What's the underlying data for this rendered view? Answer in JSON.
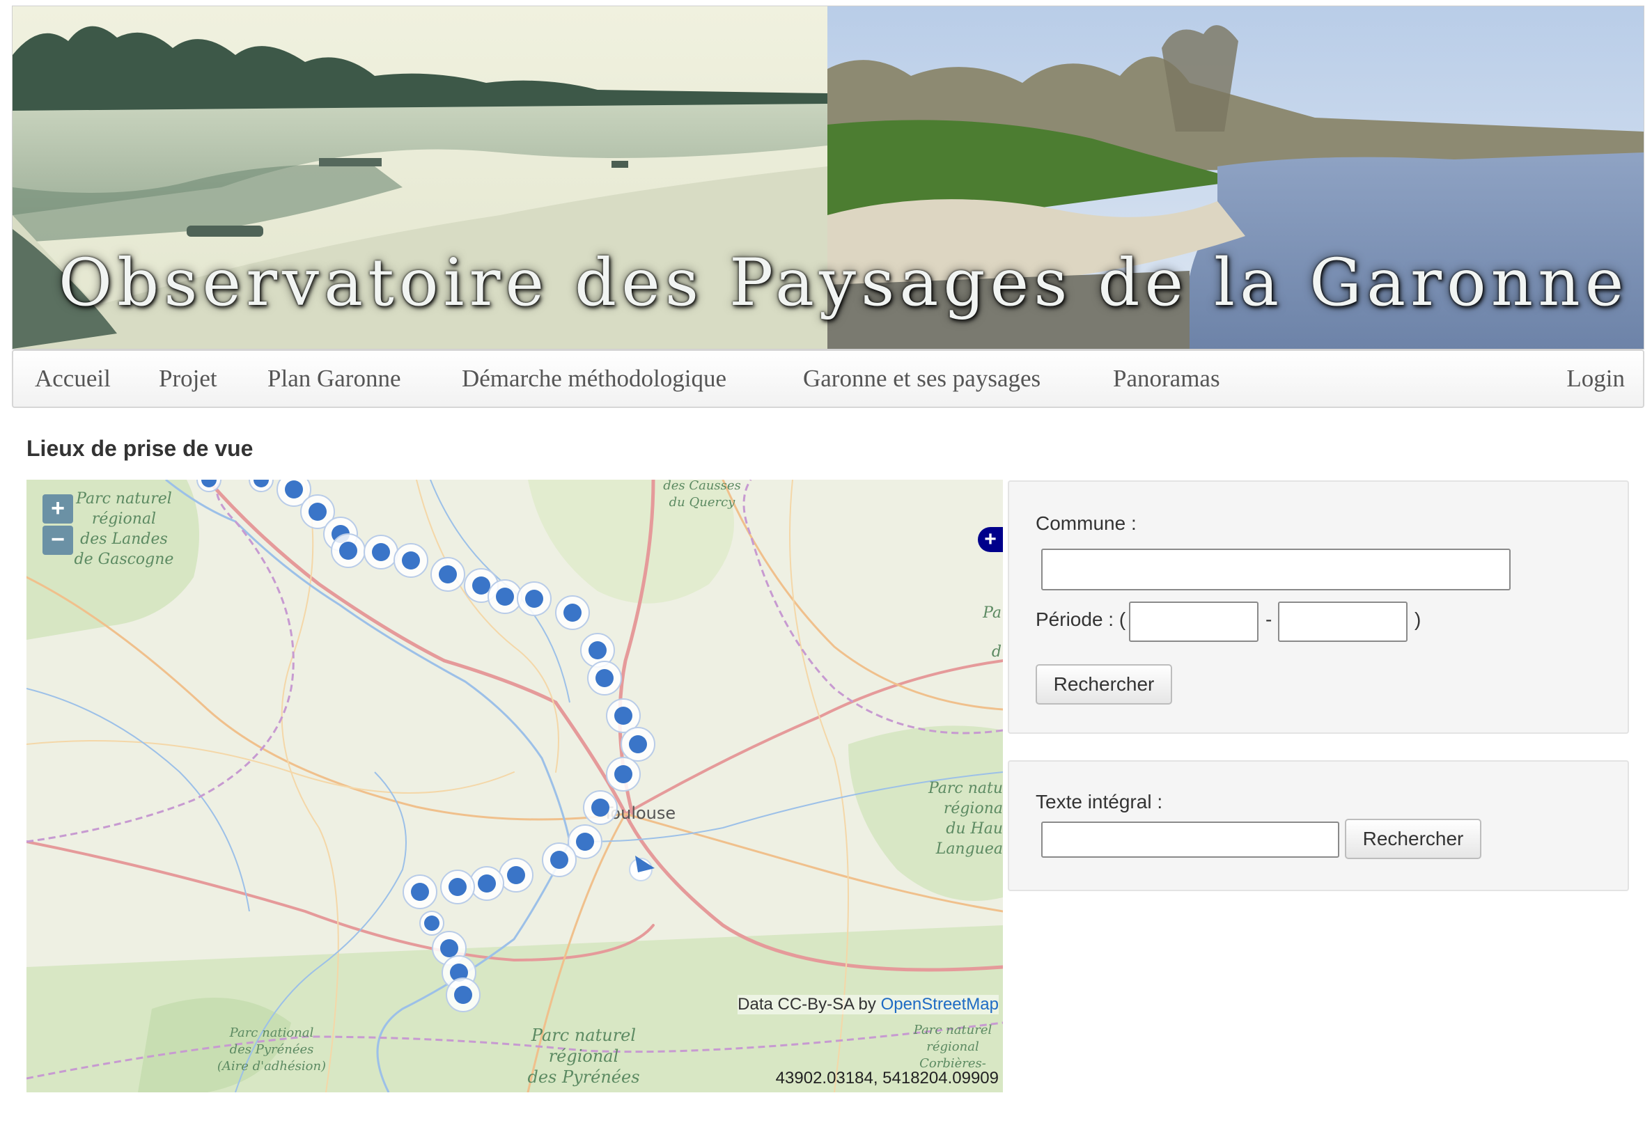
{
  "banner": {
    "title": "Observatoire des Paysages de la Garonne"
  },
  "nav": {
    "items": [
      {
        "label": "Accueil"
      },
      {
        "label": "Projet"
      },
      {
        "label": "Plan Garonne"
      },
      {
        "label": "Démarche méthodologique"
      },
      {
        "label": "Garonne et ses paysages"
      },
      {
        "label": "Panoramas"
      }
    ],
    "login": "Login"
  },
  "page": {
    "title": "Lieux de prise de vue"
  },
  "map": {
    "zoom_in": "+",
    "zoom_out": "−",
    "layer_switcher": "+",
    "labels": {
      "parc_landes": [
        "Parc naturel",
        "régional",
        "des Landes",
        "de Gascogne"
      ],
      "causses": [
        "des Causses",
        "du Quercy"
      ],
      "toulouse": "Toulouse",
      "parc_haut_languedoc": [
        "Parc natu",
        "régiona",
        "du Hau",
        "Languea"
      ],
      "parc_national_pyrenees": [
        "Parc national",
        "des Pyrénées",
        "(Aire d'adhésion)"
      ],
      "parc_pyrenees_ariegeoises": [
        "Parc naturel",
        "régional",
        "des Pyrénées"
      ],
      "parc_corbieres": [
        "Parc naturel",
        "régional",
        "Corbières-"
      ],
      "edge_pa": "Pa",
      "edge_d": "d"
    },
    "attribution_prefix": "Data CC-By-SA by ",
    "attribution_link": "OpenStreetMap",
    "mouse_position": "43902.03184, 5418204.09909",
    "marker_color": "#3a75c8"
  },
  "search": {
    "commune_label": "Commune :",
    "commune_value": "",
    "periode_label": "Période : (",
    "periode_start": "",
    "periode_separator": "-",
    "periode_end": "",
    "periode_close": ")",
    "button": "Rechercher"
  },
  "fulltext": {
    "label": "Texte intégral :",
    "value": "",
    "button": "Rechercher"
  }
}
